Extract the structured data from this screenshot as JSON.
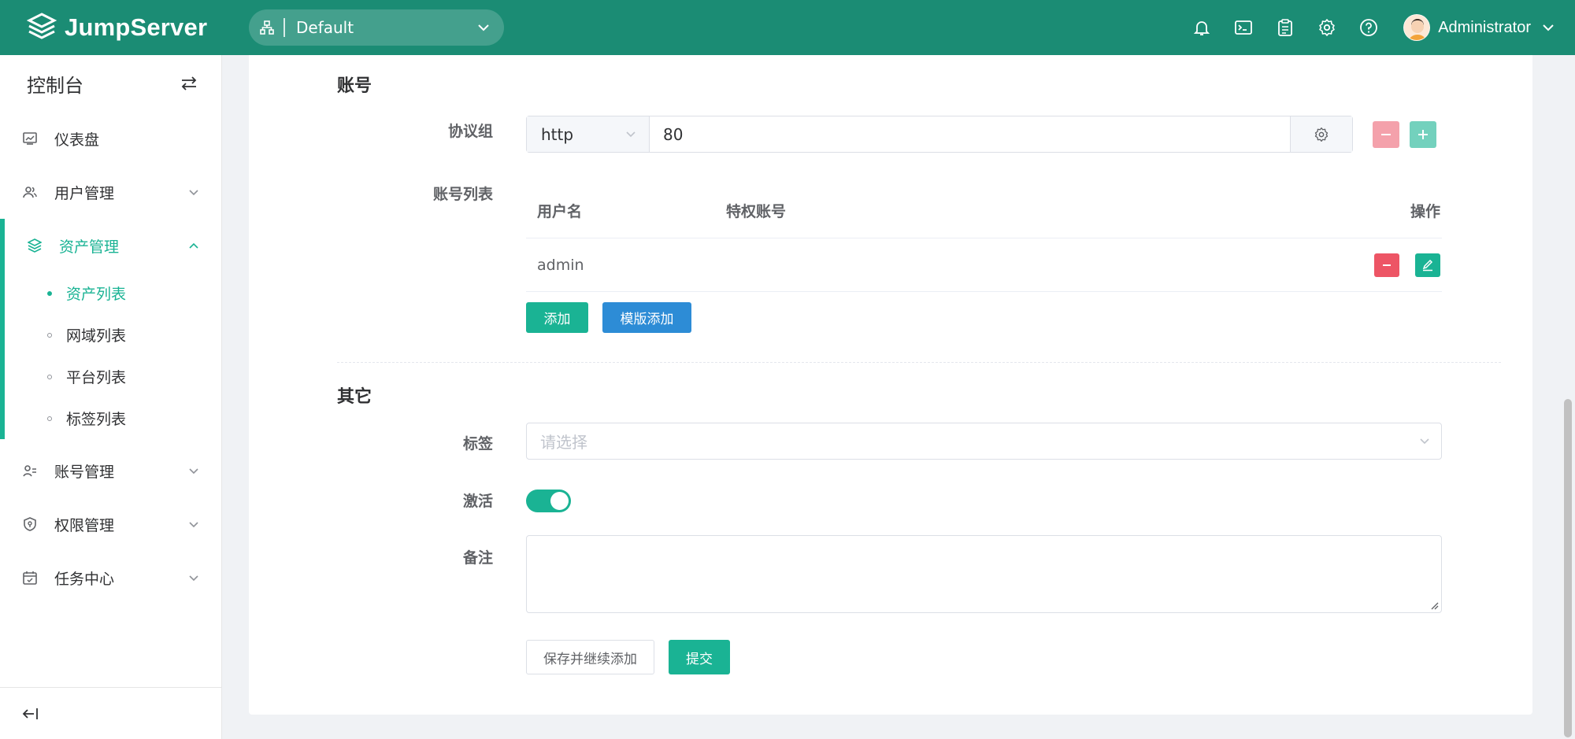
{
  "app": {
    "brand": "JumpServer",
    "org": "Default",
    "user": "Administrator"
  },
  "header": {
    "icons": [
      "bell-icon",
      "terminal-icon",
      "clipboard-icon",
      "gear-icon",
      "help-icon"
    ]
  },
  "sidebar": {
    "title": "控制台",
    "items": [
      {
        "label": "仪表盘"
      },
      {
        "label": "用户管理"
      },
      {
        "label": "资产管理"
      },
      {
        "label": "账号管理"
      },
      {
        "label": "权限管理"
      },
      {
        "label": "任务中心"
      }
    ],
    "asset_sub": [
      {
        "label": "资产列表"
      },
      {
        "label": "网域列表"
      },
      {
        "label": "平台列表"
      },
      {
        "label": "标签列表"
      }
    ]
  },
  "form": {
    "account_section": "账号",
    "protocol_label": "协议组",
    "protocol": "http",
    "port": "80",
    "account_list_label": "账号列表",
    "table_headers": {
      "username": "用户名",
      "privileged": "特权账号",
      "actions": "操作"
    },
    "accounts": [
      {
        "username": "admin",
        "privileged": ""
      }
    ],
    "add_button": "添加",
    "template_add_button": "模版添加",
    "other_section": "其它",
    "tags_label": "标签",
    "tags_placeholder": "请选择",
    "active_label": "激活",
    "active": true,
    "comment_label": "备注",
    "comment": "",
    "save_continue_button": "保存并继续添加",
    "submit_button": "提交"
  },
  "colors": {
    "header": "#1b8c74",
    "primary": "#1ab394",
    "info": "#2d8cd6",
    "danger": "#ed5565"
  }
}
